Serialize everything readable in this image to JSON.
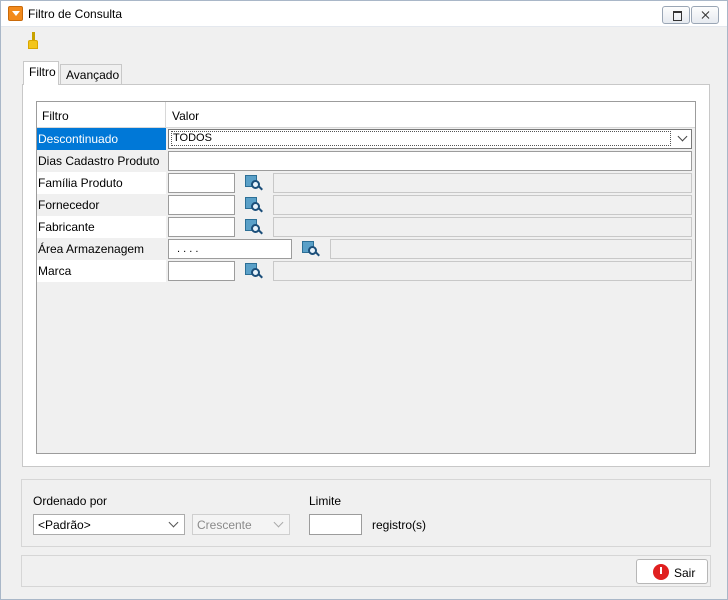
{
  "window": {
    "title": "Filtro de Consulta"
  },
  "tabs": [
    {
      "label": "Filtro",
      "active": true
    },
    {
      "label": "Avançado",
      "active": false
    }
  ],
  "grid": {
    "columns": [
      "Filtro",
      "Valor"
    ],
    "rows": [
      {
        "label": "Descontinuado",
        "value": "TODOS"
      },
      {
        "label": "Dias Cadastro Produto",
        "value": ""
      },
      {
        "label": "Família Produto",
        "value": ""
      },
      {
        "label": "Fornecedor",
        "value": ""
      },
      {
        "label": "Fabricante",
        "value": ""
      },
      {
        "label": "Área Armazenagem",
        "value": " .  .  .  ."
      },
      {
        "label": "Marca",
        "value": ""
      }
    ]
  },
  "order": {
    "label": "Ordenado por",
    "selected": "<Padrão>",
    "direction": "Crescente"
  },
  "limit": {
    "label": "Limite",
    "value": "",
    "unit": "registro(s)"
  },
  "footer": {
    "exit_label": "Sair"
  },
  "colors": {
    "selection": "#0078d7",
    "exit_icon": "#e02020",
    "app_icon": "#f28a1c"
  }
}
